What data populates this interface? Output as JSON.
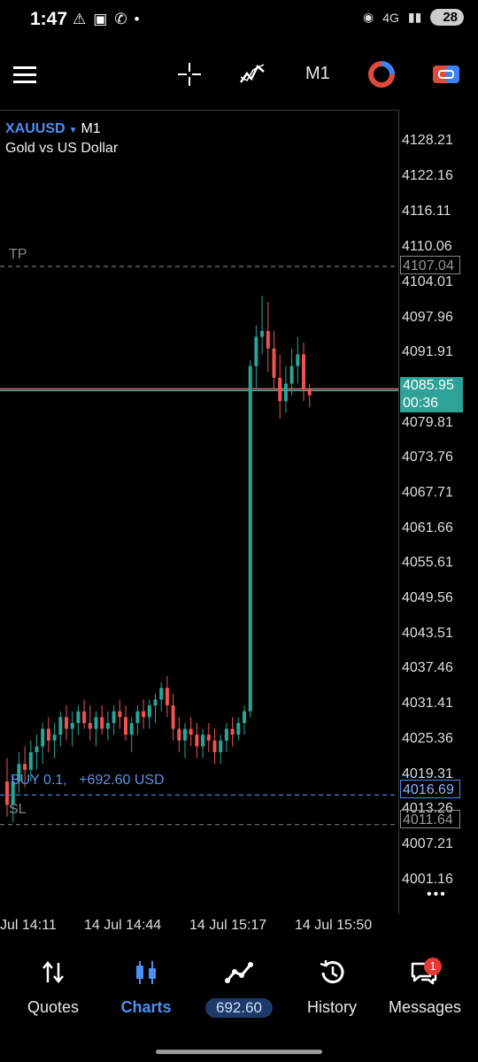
{
  "status_bar": {
    "time": "1:47",
    "network": "4G",
    "battery": "28"
  },
  "toolbar": {
    "timeframe": "M1"
  },
  "chart_header": {
    "symbol": "XAUUSD",
    "timeframe": "M1",
    "description": "Gold vs US Dollar"
  },
  "price_axis": {
    "labels": [
      "4128.21",
      "4122.16",
      "4116.11",
      "4110.06",
      "4104.01",
      "4097.96",
      "4091.91",
      "4079.81",
      "4073.76",
      "4067.71",
      "4061.66",
      "4055.61",
      "4049.56",
      "4043.51",
      "4037.46",
      "4031.41",
      "4025.36",
      "4019.31",
      "4013.26",
      "4007.21",
      "4001.16"
    ],
    "current_price": "4085.95",
    "countdown": "00:36",
    "tp_price": "4107.04",
    "entry_price": "4016.69",
    "sl_price": "4011.64"
  },
  "time_axis": {
    "labels": [
      "Jul 14:11",
      "14 Jul 14:44",
      "14 Jul 15:17",
      "14 Jul 15:50"
    ]
  },
  "order_lines": {
    "tp_label": "TP",
    "sl_label": "SL",
    "position_label": "BUY 0.1,",
    "position_profit": "+692.60 USD"
  },
  "chart_data": {
    "type": "candlestick",
    "title": "XAUUSD M1",
    "ylim": [
      3996,
      4132
    ],
    "candles": [
      [
        4019,
        4023,
        4013,
        4015
      ],
      [
        4015,
        4020,
        4012,
        4019
      ],
      [
        4019,
        4024,
        4017,
        4022
      ],
      [
        4022,
        4025,
        4018,
        4021
      ],
      [
        4021,
        4026,
        4019,
        4024
      ],
      [
        4024,
        4027,
        4021,
        4025
      ],
      [
        4025,
        4029,
        4022,
        4028
      ],
      [
        4028,
        4030,
        4024,
        4026
      ],
      [
        4026,
        4029,
        4023,
        4027
      ],
      [
        4027,
        4031,
        4025,
        4030
      ],
      [
        4030,
        4032,
        4026,
        4028
      ],
      [
        4028,
        4031,
        4025,
        4029
      ],
      [
        4029,
        4032,
        4027,
        4031
      ],
      [
        4031,
        4033,
        4028,
        4029
      ],
      [
        4029,
        4032,
        4026,
        4028
      ],
      [
        4028,
        4031,
        4025,
        4030
      ],
      [
        4030,
        4032,
        4027,
        4028
      ],
      [
        4028,
        4031,
        4026,
        4029
      ],
      [
        4029,
        4032,
        4027,
        4031
      ],
      [
        4031,
        4033,
        4028,
        4030
      ],
      [
        4030,
        4032,
        4026,
        4027
      ],
      [
        4027,
        4030,
        4024,
        4029
      ],
      [
        4029,
        4032,
        4027,
        4031
      ],
      [
        4031,
        4033,
        4028,
        4030
      ],
      [
        4030,
        4033,
        4028,
        4032
      ],
      [
        4032,
        4034,
        4029,
        4033
      ],
      [
        4033,
        4036,
        4031,
        4035
      ],
      [
        4035,
        4037,
        4030,
        4032
      ],
      [
        4032,
        4034,
        4026,
        4028
      ],
      [
        4028,
        4030,
        4024,
        4026
      ],
      [
        4026,
        4029,
        4023,
        4028
      ],
      [
        4028,
        4030,
        4025,
        4027
      ],
      [
        4027,
        4029,
        4023,
        4025
      ],
      [
        4025,
        4028,
        4023,
        4027
      ],
      [
        4027,
        4029,
        4024,
        4026
      ],
      [
        4026,
        4028,
        4022,
        4024
      ],
      [
        4024,
        4027,
        4022,
        4026
      ],
      [
        4026,
        4029,
        4024,
        4028
      ],
      [
        4028,
        4030,
        4025,
        4027
      ],
      [
        4027,
        4030,
        4026,
        4029
      ],
      [
        4029,
        4032,
        4027,
        4031
      ],
      [
        4031,
        4091,
        4030,
        4090
      ],
      [
        4090,
        4097,
        4086,
        4095
      ],
      [
        4095,
        4102,
        4092,
        4096
      ],
      [
        4096,
        4101,
        4089,
        4093
      ],
      [
        4093,
        4096,
        4086,
        4088
      ],
      [
        4088,
        4092,
        4081,
        4084
      ],
      [
        4084,
        4090,
        4082,
        4087
      ],
      [
        4087,
        4093,
        4085,
        4090
      ],
      [
        4090,
        4095,
        4087,
        4092
      ],
      [
        4092,
        4094,
        4084,
        4086
      ],
      [
        4086,
        4087,
        4083,
        4085
      ]
    ]
  },
  "bottom_nav": {
    "items": [
      {
        "label": "Quotes",
        "icon": "arrows-icon"
      },
      {
        "label": "Charts",
        "icon": "candles-icon"
      },
      {
        "label": "692.60",
        "icon": "trade-icon"
      },
      {
        "label": "History",
        "icon": "history-icon"
      },
      {
        "label": "Messages",
        "icon": "messages-icon"
      }
    ],
    "messages_badge": "1"
  },
  "colors": {
    "bull": "#26a69a",
    "bear": "#ef5350",
    "accent": "#4d8ff5",
    "price_bg": "#2ea297"
  }
}
